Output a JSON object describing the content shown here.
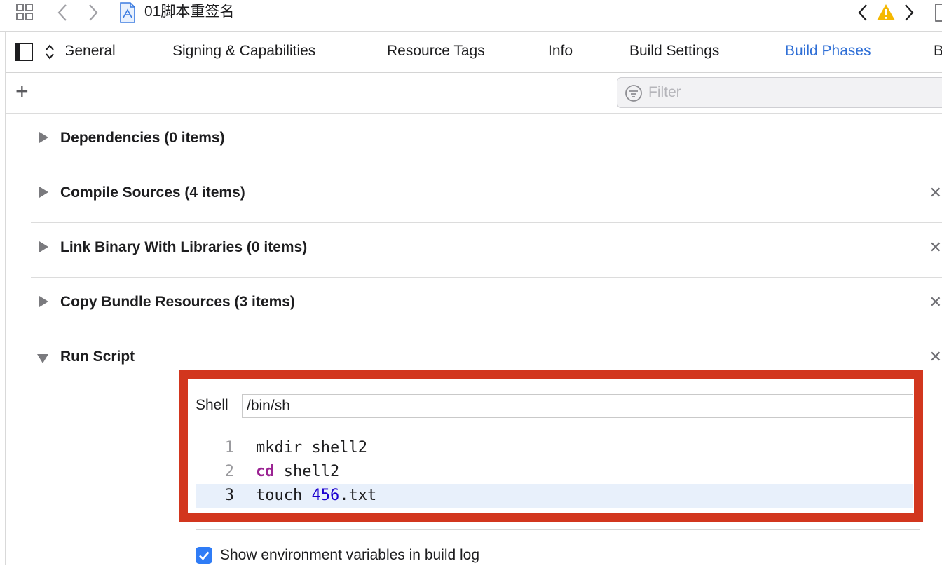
{
  "window": {
    "title": "01脚本重签名"
  },
  "tabs": [
    {
      "label": "General"
    },
    {
      "label": "Signing & Capabilities"
    },
    {
      "label": "Resource Tags"
    },
    {
      "label": "Info"
    },
    {
      "label": "Build Settings"
    },
    {
      "label": "Build Phases",
      "active": true
    },
    {
      "label": "B"
    }
  ],
  "toolbar": {
    "add_symbol": "+",
    "filter_placeholder": "Filter"
  },
  "phases": [
    {
      "label": "Dependencies (0 items)",
      "expanded": false,
      "removable": false
    },
    {
      "label": "Compile Sources (4 items)",
      "expanded": false,
      "removable": true
    },
    {
      "label": "Link Binary With Libraries (0 items)",
      "expanded": false,
      "removable": true
    },
    {
      "label": "Copy Bundle Resources (3 items)",
      "expanded": false,
      "removable": true
    },
    {
      "label": "Run Script",
      "expanded": true,
      "removable": true
    }
  ],
  "close_symbol": "✕",
  "run_script": {
    "shell_label": "Shell",
    "shell_value": "/bin/sh",
    "lines": [
      {
        "num": "1",
        "text": "mkdir shell2"
      },
      {
        "num": "2",
        "keyword": "cd",
        "rest": " shell2"
      },
      {
        "num": "3",
        "pre": "touch ",
        "number": "456",
        "post": ".txt",
        "current": true
      }
    ],
    "env_checkbox_label": "Show environment variables in build log",
    "env_checked": true
  },
  "colors": {
    "accent": "#2f6fd6",
    "highlight_frame": "#d2361e",
    "keyword": "#9b2393",
    "number_literal": "#1c00cf",
    "warning": "#f5b800"
  },
  "icons": [
    "grid-icon",
    "back-chevron-icon",
    "forward-chevron-icon",
    "project-file-icon",
    "warning-icon",
    "sidebar-toggle-icon",
    "target-selector-icon",
    "add-icon",
    "filter-icon",
    "disclosure-triangle-icon",
    "close-icon",
    "checkbox-checked-icon"
  ]
}
